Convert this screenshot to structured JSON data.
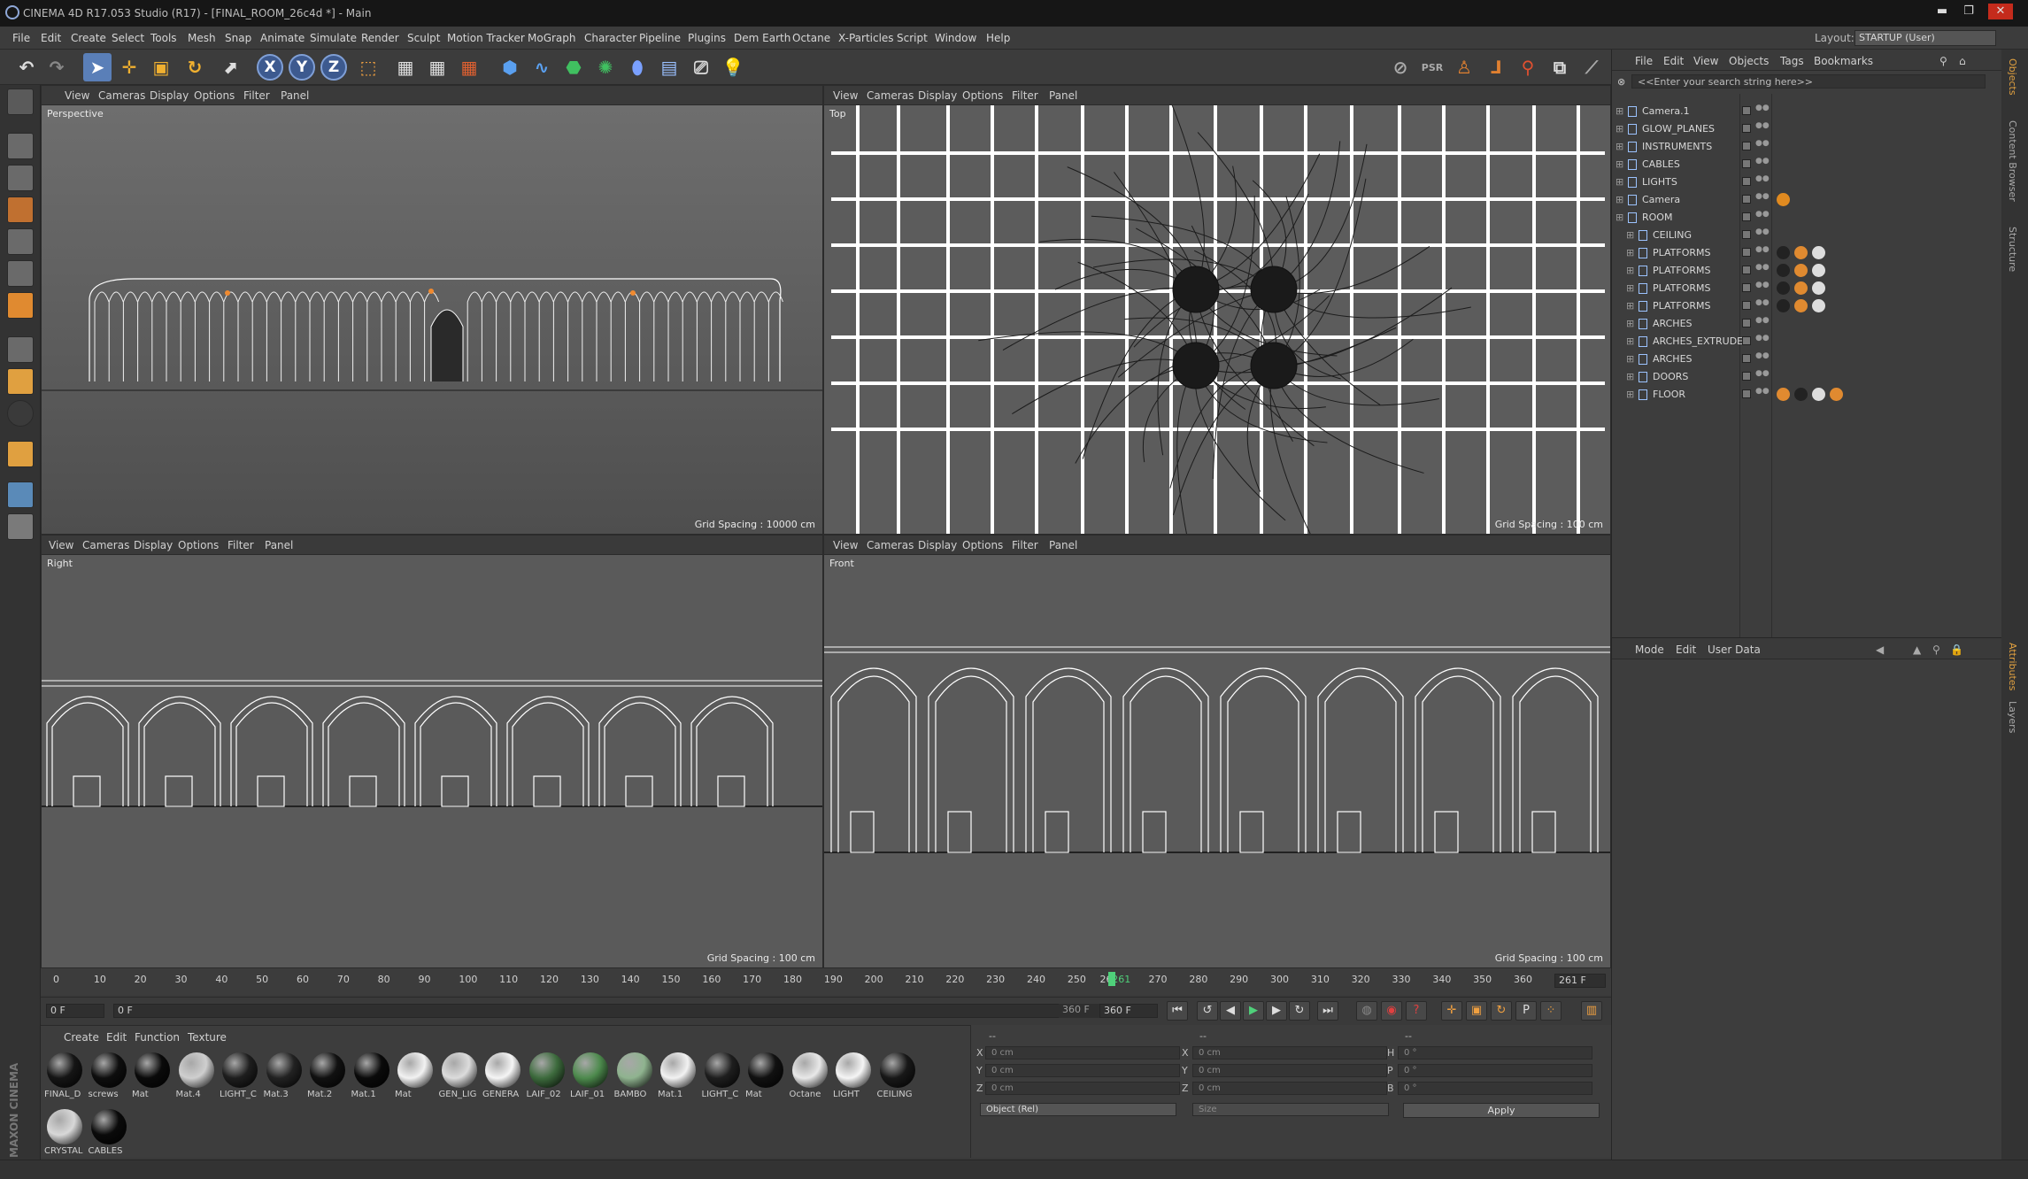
{
  "window": {
    "title": "CINEMA 4D R17.053 Studio (R17) - [FINAL_ROOM_26c4d *] - Main",
    "minimize": "▬",
    "maximize": "❐",
    "close": "✕"
  },
  "menu": [
    "File",
    "Edit",
    "Create",
    "Select",
    "Tools",
    "Mesh",
    "Snap",
    "Animate",
    "Simulate",
    "Render",
    "Sculpt",
    "Motion Tracker",
    "MoGraph",
    "Character",
    "Pipeline",
    "Plugins",
    "Dem Earth",
    "Octane",
    "X-Particles",
    "Script",
    "Window",
    "Help"
  ],
  "layout": {
    "label": "Layout:",
    "value": "STARTUP (User)"
  },
  "toolbar": {
    "axis_x": "X",
    "axis_y": "Y",
    "axis_z": "Z"
  },
  "viewports": [
    {
      "name": "Perspective",
      "menu": [
        "View",
        "Cameras",
        "Display",
        "Options",
        "Filter",
        "Panel"
      ],
      "grid": "Grid Spacing : 10000 cm"
    },
    {
      "name": "Top",
      "menu": [
        "View",
        "Cameras",
        "Display",
        "Options",
        "Filter",
        "Panel"
      ],
      "grid": "Grid Spacing : 100 cm"
    },
    {
      "name": "Right",
      "menu": [
        "View",
        "Cameras",
        "Display",
        "Options",
        "Filter",
        "Panel"
      ],
      "grid": "Grid Spacing : 100 cm"
    },
    {
      "name": "Front",
      "menu": [
        "View",
        "Cameras",
        "Display",
        "Options",
        "Filter",
        "Panel"
      ],
      "grid": "Grid Spacing : 100 cm"
    }
  ],
  "object_manager": {
    "menu": [
      "File",
      "Edit",
      "View",
      "Objects",
      "Tags",
      "Bookmarks"
    ],
    "search_placeholder": "<<Enter your search string here>>",
    "objects": [
      {
        "name": "Camera.1",
        "indent": 0
      },
      {
        "name": "GLOW_PLANES",
        "indent": 0
      },
      {
        "name": "INSTRUMENTS",
        "indent": 0
      },
      {
        "name": "CABLES",
        "indent": 0
      },
      {
        "name": "LIGHTS",
        "indent": 0
      },
      {
        "name": "Camera",
        "indent": 0
      },
      {
        "name": "ROOM",
        "indent": 0
      },
      {
        "name": "CEILING",
        "indent": 1
      },
      {
        "name": "PLATFORMS",
        "indent": 1
      },
      {
        "name": "PLATFORMS",
        "indent": 1
      },
      {
        "name": "PLATFORMS",
        "indent": 1
      },
      {
        "name": "PLATFORMS",
        "indent": 1
      },
      {
        "name": "ARCHES",
        "indent": 1
      },
      {
        "name": "ARCHES_EXTRUDE",
        "indent": 1
      },
      {
        "name": "ARCHES",
        "indent": 1
      },
      {
        "name": "DOORS",
        "indent": 1
      },
      {
        "name": "FLOOR",
        "indent": 1
      }
    ]
  },
  "attribute_manager": {
    "menu": [
      "Mode",
      "Edit",
      "User Data"
    ]
  },
  "side_tabs": [
    "Objects",
    "Content Browser",
    "Structure",
    "Attributes",
    "Layers"
  ],
  "timeline": {
    "ticks": [
      "0",
      "10",
      "20",
      "30",
      "40",
      "50",
      "60",
      "70",
      "80",
      "90",
      "100",
      "110",
      "120",
      "130",
      "140",
      "150",
      "160",
      "170",
      "180",
      "190",
      "200",
      "210",
      "220",
      "230",
      "240",
      "250",
      "26",
      "261",
      "270",
      "280",
      "290",
      "300",
      "310",
      "320",
      "330",
      "340",
      "350",
      "360"
    ],
    "current_frame": "261 F",
    "current": 261,
    "start": "0 F",
    "range_start": "0 F",
    "range_end": "360 F",
    "end": "360 F"
  },
  "materials": {
    "menu": [
      "Create",
      "Edit",
      "Function",
      "Texture"
    ],
    "items": [
      {
        "name": "FINAL_D",
        "color": "#151515"
      },
      {
        "name": "screws",
        "color": "#0e0e0e"
      },
      {
        "name": "Mat",
        "color": "#0a0a0a"
      },
      {
        "name": "Mat.4",
        "color": "#cfcfcf"
      },
      {
        "name": "LIGHT_C",
        "color": "#1e1e1e"
      },
      {
        "name": "Mat.3",
        "color": "#222222"
      },
      {
        "name": "Mat.2",
        "color": "#111111"
      },
      {
        "name": "Mat.1",
        "color": "#0a0a0a"
      },
      {
        "name": "Mat",
        "color": "#f2f2f2"
      },
      {
        "name": "GEN_LIG",
        "color": "#dcdcdc"
      },
      {
        "name": "GENERA",
        "color": "#f5f5f5"
      },
      {
        "name": "LAIF_02",
        "color": "#3d6b3d"
      },
      {
        "name": "LAIF_01",
        "color": "#4d8a4d"
      },
      {
        "name": "BAMBO",
        "color": "#8fb38f"
      },
      {
        "name": "Mat.1",
        "color": "#f2f2f2"
      },
      {
        "name": "LIGHT_C",
        "color": "#1e1e1e"
      },
      {
        "name": "Mat",
        "color": "#111111"
      },
      {
        "name": "Octane",
        "color": "#e8e8e8"
      },
      {
        "name": "LIGHT",
        "color": "#f5f5f5"
      },
      {
        "name": "CEILING",
        "color": "#181818"
      },
      {
        "name": "CRYSTAL",
        "color": "#d8d8d8"
      },
      {
        "name": "CABLES",
        "color": "#0a0a0a"
      }
    ]
  },
  "coordinates": {
    "rows": [
      {
        "a": "X",
        "av": "0 cm",
        "b": "X",
        "bv": "0 cm",
        "c": "H",
        "cv": "0 °"
      },
      {
        "a": "Y",
        "av": "0 cm",
        "b": "Y",
        "bv": "0 cm",
        "c": "P",
        "cv": "0 °"
      },
      {
        "a": "Z",
        "av": "0 cm",
        "b": "Z",
        "bv": "0 cm",
        "c": "B",
        "cv": "0 °"
      }
    ],
    "header_a": "--",
    "header_b": "--",
    "header_c": "--",
    "mode": "Object (Rel)",
    "size": "Size",
    "apply": "Apply"
  },
  "brand": "MAXON CINEMA 4D"
}
